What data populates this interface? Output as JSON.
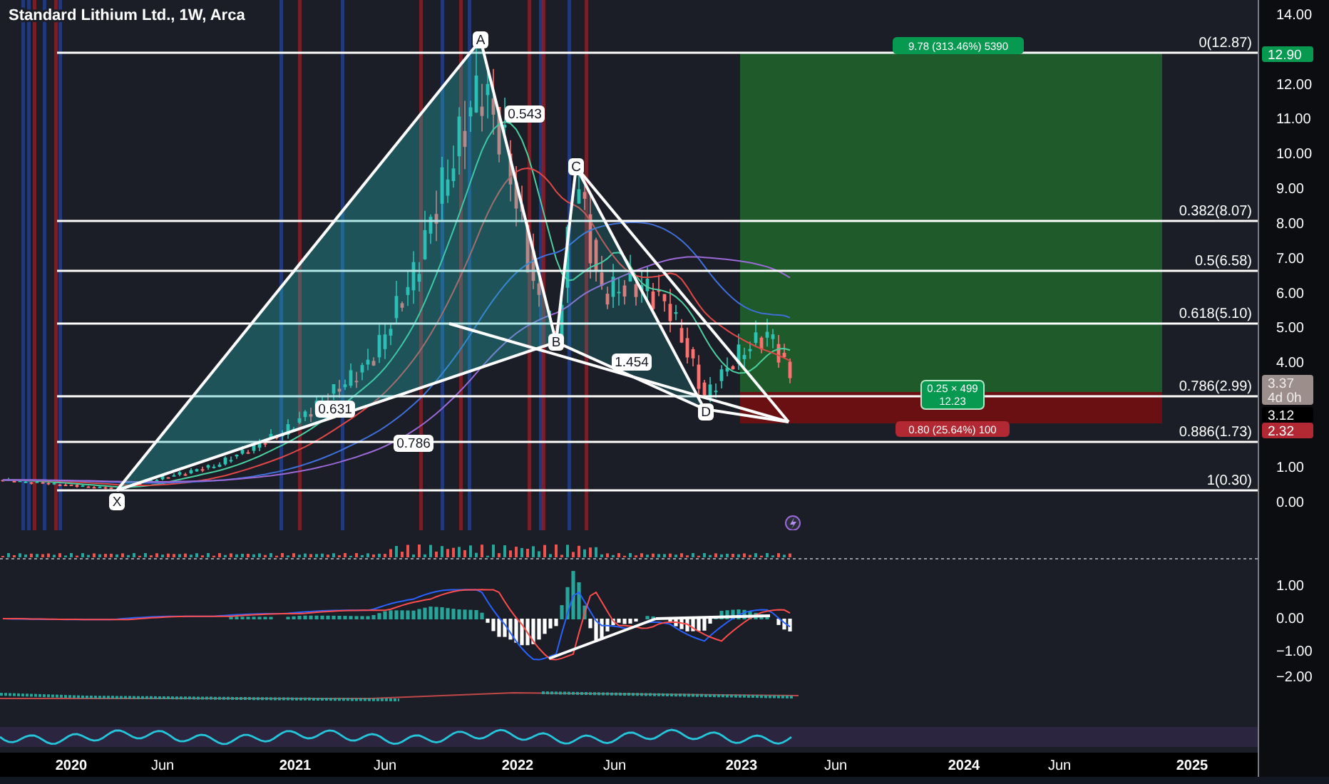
{
  "chart": {
    "title": "Standard Lithium Ltd., 1W, Arca"
  },
  "pattern": {
    "points": [
      {
        "label": "X"
      },
      {
        "label": "A"
      },
      {
        "label": "B"
      },
      {
        "label": "C"
      },
      {
        "label": "D"
      }
    ],
    "ratios": [
      {
        "label": "0.543"
      },
      {
        "label": "0.631"
      },
      {
        "label": "0.786"
      },
      {
        "label": "1.454"
      }
    ]
  },
  "fib_levels": [
    {
      "label": "0(12.87)"
    },
    {
      "label": "0.382(8.07)"
    },
    {
      "label": "0.5(6.58)"
    },
    {
      "label": "0.618(5.10)"
    },
    {
      "label": "0.786(2.99)"
    },
    {
      "label": "0.886(1.73)"
    },
    {
      "label": "1(0.30)"
    }
  ],
  "position": {
    "target_label": "9.78 (313.46%) 5390",
    "center_label": "0.25 × 499",
    "center_sublabel": "12.23",
    "stop_label": "0.80 (25.64%) 100"
  },
  "price_axis": {
    "ticks": [
      "14.00",
      "12.00",
      "11.00",
      "10.00",
      "9.00",
      "8.00",
      "7.00",
      "6.00",
      "5.00",
      "4.00",
      "1.00",
      "0.00"
    ],
    "markers": [
      {
        "kind": "target",
        "text": "12.90"
      },
      {
        "kind": "last",
        "text": "3.37",
        "countdown": "4d 0h"
      },
      {
        "kind": "entry",
        "text": "3.12"
      },
      {
        "kind": "stop",
        "text": "2.32"
      }
    ]
  },
  "macd_axis": {
    "ticks": [
      "1.00",
      "0.00",
      "−1.00",
      "−2.00"
    ]
  },
  "time_axis": {
    "labels": [
      "2020",
      "Jun",
      "2021",
      "Jun",
      "2022",
      "Jun",
      "2023",
      "Jun",
      "2024",
      "Jun",
      "2025"
    ]
  }
}
